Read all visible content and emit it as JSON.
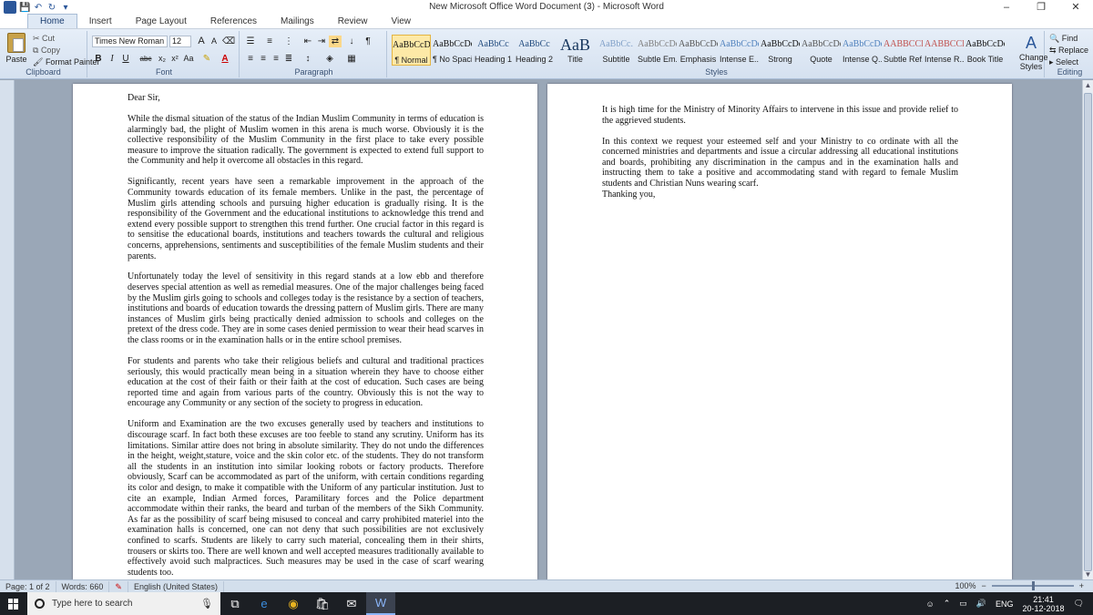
{
  "window": {
    "title": "New Microsoft Office Word Document (3) - Microsoft Word",
    "minimize": "–",
    "maximize": "❐",
    "close": "✕"
  },
  "qat": {
    "save": "💾",
    "undo": "↶",
    "redo": "↻",
    "more": "▾"
  },
  "tabs": [
    "Home",
    "Insert",
    "Page Layout",
    "References",
    "Mailings",
    "Review",
    "View"
  ],
  "ribbon": {
    "clipboard": {
      "label": "Clipboard",
      "paste": "Paste",
      "cut": "Cut",
      "copy": "Copy",
      "format_painter": "Format Painter"
    },
    "font": {
      "label": "Font",
      "font_name": "Times New Roman (Hea",
      "font_size": "12",
      "bold": "B",
      "italic": "I",
      "underline": "U",
      "strike": "abc",
      "subscript": "x₂",
      "superscript": "x²",
      "change_case": "Aa",
      "grow": "A",
      "shrink": "A"
    },
    "paragraph": {
      "label": "Paragraph",
      "show_marks": "¶"
    },
    "styles": {
      "label": "Styles",
      "items": [
        {
          "sample": "AaBbCcDc",
          "name": "¶ Normal"
        },
        {
          "sample": "AaBbCcDc",
          "name": "¶ No Spaci..."
        },
        {
          "sample": "AaBbCc",
          "name": "Heading 1"
        },
        {
          "sample": "AaBbCc",
          "name": "Heading 2"
        },
        {
          "sample": "AaB",
          "name": "Title"
        },
        {
          "sample": "AaBbCc.",
          "name": "Subtitle"
        },
        {
          "sample": "AaBbCcDd",
          "name": "Subtle Em..."
        },
        {
          "sample": "AaBbCcDd",
          "name": "Emphasis"
        },
        {
          "sample": "AaBbCcDd",
          "name": "Intense E..."
        },
        {
          "sample": "AaBbCcDc",
          "name": "Strong"
        },
        {
          "sample": "AaBbCcDd",
          "name": "Quote"
        },
        {
          "sample": "AaBbCcDd",
          "name": "Intense Q..."
        },
        {
          "sample": "AABBCCDE",
          "name": "Subtle Ref..."
        },
        {
          "sample": "AABBCCDE",
          "name": "Intense R..."
        },
        {
          "sample": "AaBbCcDc",
          "name": "Book Title"
        }
      ],
      "change_styles": "Change Styles"
    },
    "editing": {
      "label": "Editing",
      "find": "Find",
      "replace": "Replace",
      "select": "Select"
    }
  },
  "document": {
    "page1": [
      "Dear Sir,",
      "While the dismal situation of the status of the Indian Muslim Community in terms of education is alarmingly bad, the plight of Muslim women in this arena is much worse. Obviously it is the collective responsibility of the Muslim Community in the first place to take every possible measure to improve the situation radically. The government is expected to extend full support to the Community and help it overcome all obstacles in this regard.",
      "Significantly, recent years have seen a remarkable improvement in the approach of the Community towards education of its female members. Unlike in the past, the percentage of Muslim girls attending schools and pursuing higher education is gradually rising. It is the responsibility of the Government and the educational institutions to acknowledge this trend and extend every possible support to strengthen this trend further. One crucial factor in this regard is to sensitise the educational boards, institutions and teachers towards the cultural and religious concerns, apprehensions, sentiments and susceptibilities of the female Muslim students and their parents.",
      "Unfortunately today the level of sensitivity in this regard stands at a low ebb and therefore deserves special attention as well as remedial measures. One of the major challenges being faced by the Muslim girls going to schools and colleges today is the resistance by a section of teachers, institutions and boards of education towards the dressing pattern of Muslim girls. There are many instances of Muslim girls being practically denied admission to schools and colleges on the pretext of the dress code. They are in some cases denied permission to wear their head scarves in the class rooms or in the examination halls or in the entire school premises.",
      "For students and parents who take their religious beliefs and cultural and traditional practices seriously, this would practically mean being in a situation wherein they have to choose either education at the cost of their faith or their faith at the cost of education. Such cases are being reported time and again from various parts of the country. Obviously this is not the way to encourage any Community or any section of the society to progress in education.",
      "Uniform and Examination are the two excuses generally used by teachers and institutions to discourage scarf. In fact both these excuses are too feeble to stand any scrutiny. Uniform has its limitations. Similar attire does not bring in absolute similarity. They do not undo the differences in the height, weight,stature, voice and the skin color etc. of the students. They do not transform all the students in an institution into similar looking robots or factory products. Therefore obviously, Scarf can be accommodated as part of the uniform, with certain conditions regarding its color and design, to make it compatible with the Uniform of any particular institution. Just to cite an example, Indian Armed forces, Paramilitary forces and the Police department accommodate within their ranks, the beard and turban of the members of the Sikh Community. As far as the possibility of scarf being misused to conceal and carry prohibited materiel into the examination halls is concerned, one can not deny that such possibilities are not exclusively confined to scarfs. Students are likely to carry such material, concealing them in their shirts, trousers or skirts too. There are well known and well accepted measures traditionally available to effectively avoid such malpractices. Such measures may be used in the case of scarf wearing students too."
    ],
    "page2": [
      "It is high time for the Ministry of Minority Affairs to intervene in this issue and provide relief to the aggrieved students.",
      "In this context we request your esteemed self and your Ministry to co ordinate with all the concerned ministries and departments and issue a circular addressing all educational institutions and boards, prohibiting any discrimination in the campus and in the examination halls and instructing them to take a positive and accommodating stand with regard to female Muslim students and Christian Nuns wearing scarf.",
      "Thanking you,"
    ]
  },
  "status": {
    "page": "Page: 1 of 2",
    "words": "Words: 660",
    "language": "English (United States)",
    "zoom": "100%"
  },
  "taskbar": {
    "search_placeholder": "Type here to search",
    "tray_lang": "ENG",
    "time": "21:41",
    "date": "20-12-2018"
  }
}
